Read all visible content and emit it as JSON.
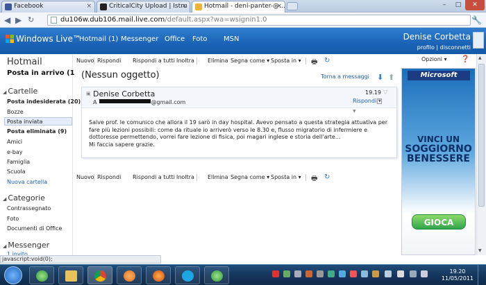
{
  "browser": {
    "tabs": [
      {
        "label": "Facebook",
        "favicon_color": "#3b5998"
      },
      {
        "label": "CriticalCity Upload | Istru",
        "favicon_color": "#222222"
      },
      {
        "label": "Hotmail - deni-panter-@...",
        "favicon_color": "#f2b134"
      }
    ],
    "close_glyph": "×",
    "url_domain": "du106w.dub106.mail.live.com",
    "url_path": "/default.aspx?wa=wsignin1.0"
  },
  "wl_header": {
    "brand": "Windows Live™",
    "nav": [
      "Hotmail (1)",
      "Messenger",
      "Office",
      "Foto",
      "MSN"
    ],
    "user_name": "Denise Corbetta",
    "profile_link": "profilo",
    "sep": "|",
    "signout_link": "disconnetti"
  },
  "sidebar": {
    "title": "Hotmail",
    "inbox": "Posta in arrivo (1",
    "folders_header": "Cartelle",
    "folders": [
      {
        "label": "Posta indesiderata (20)",
        "bold": true
      },
      {
        "label": "Bozze"
      },
      {
        "label": "Posta inviata",
        "selected": true
      },
      {
        "label": "Posta eliminata (9)",
        "bold": true
      },
      {
        "label": "Amici"
      },
      {
        "label": "e-bay"
      },
      {
        "label": "Famiglia"
      },
      {
        "label": "Scuola"
      }
    ],
    "new_folder": "Nuova cartella",
    "categories_header": "Categorie",
    "categories": [
      "Contrassegnato",
      "Foto",
      "Documenti di Office"
    ],
    "messenger_header": "Messenger",
    "messenger_invite": "1 invito"
  },
  "toolbar": {
    "new": "Nuovo",
    "reply": "Rispondi",
    "reply_all": "Rispondi a tutti",
    "forward": "Inoltra",
    "delete": "Elimina",
    "mark_as": "Segna come ▾",
    "move_to": "Sposta in ▾",
    "options": "Opzioni ▾"
  },
  "message": {
    "subject": "(Nessun oggetto)",
    "back_link": "Torna a messaggi",
    "sender": "Denise Corbetta",
    "to_prefix": "A",
    "to_suffix": "@gmail.com",
    "time": "19.19",
    "reply_link": "Rispondi",
    "body_lines": [
      "Salve prof. le comunico che allora il 19 sarò in day hospital. Avevo pensato a questa strategia attuativa per",
      "fare più lezioni possibili: come da rituale io arriverò verso le 8.30 e, flusso migratorio di infermiere e",
      "dottoresse permettendo, vorrei fare lezione di fisica, poi magari inglese e storia dell'arte...",
      "Mi faccia sapere grazie."
    ]
  },
  "ad": {
    "brand": "Microsoft",
    "line1": "VINCI UN",
    "line2": "SOGGIORNO",
    "line3": "BENESSERE",
    "cta": "GIOCA"
  },
  "status_bar": "javascript:void(0);",
  "taskbar": {
    "time": "19.20",
    "date": "11/05/2011"
  }
}
